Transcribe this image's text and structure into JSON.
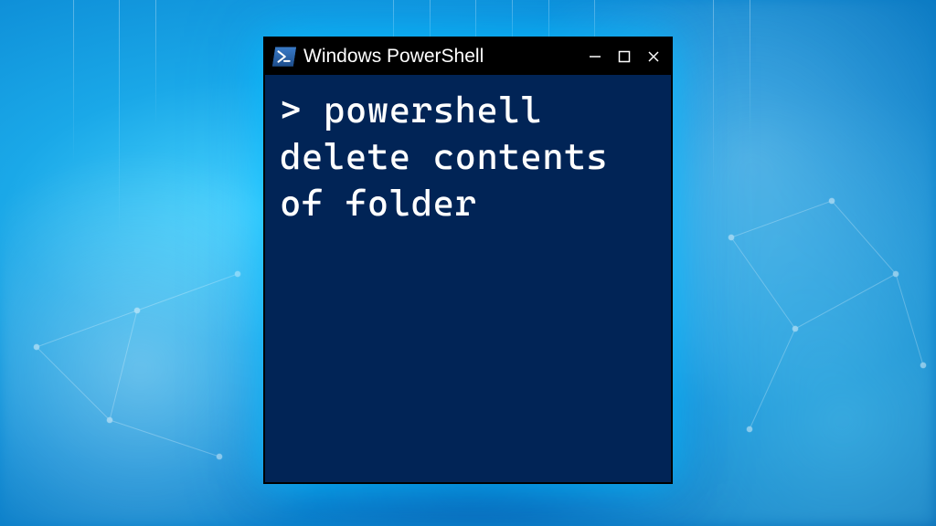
{
  "window": {
    "title": "Windows PowerShell",
    "icon_name": "powershell-icon",
    "controls": {
      "minimize": "–",
      "maximize": "□",
      "close": "×"
    }
  },
  "terminal": {
    "prompt": ">",
    "command": "powershell delete contents of folder"
  },
  "colors": {
    "terminal_bg": "#012456",
    "titlebar_bg": "#000000",
    "text": "#ffffff",
    "accent_blue": "#2e8ad8"
  }
}
